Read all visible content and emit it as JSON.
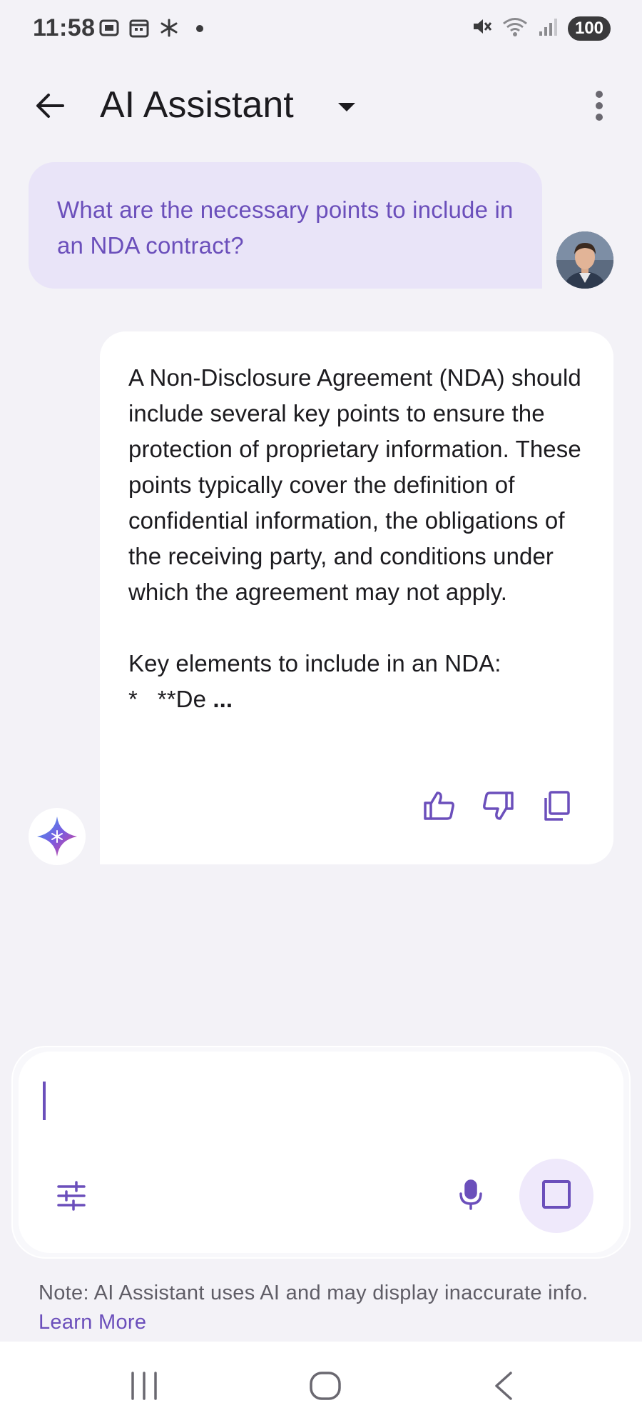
{
  "status_bar": {
    "time": "11:58",
    "battery": "100",
    "icons": [
      "screenshot-icon",
      "calendar-icon",
      "asterisk-icon",
      "dot-icon",
      "mute-icon",
      "wifi-icon",
      "signal-icon"
    ]
  },
  "app_bar": {
    "title": "AI Assistant",
    "icons": [
      "back-arrow-icon",
      "dropdown-caret-icon",
      "more-vert-icon"
    ]
  },
  "conversation": {
    "user_message": "What are the necessary points to include in an NDA contract?",
    "assistant_message": "A Non-Disclosure Agreement (NDA) should include several key points to ensure the protection of proprietary information. These points typically cover the definition of confidential information, the obligations of the receiving party, and conditions under which the agreement may not apply.\n\nKey elements to include in an NDA:\n*   **De",
    "assistant_ellipsis": "...",
    "feedback_icons": [
      "thumb-up-icon",
      "thumb-down-icon",
      "copy-icon"
    ]
  },
  "composer": {
    "input_value": "",
    "icons": [
      "tune-icon",
      "mic-icon",
      "stop-icon"
    ]
  },
  "footer": {
    "note_text": "Note: AI Assistant uses AI and may display inaccurate info. ",
    "learn_more": "Learn More"
  },
  "colors": {
    "accent": "#6b4fbb",
    "user_bubble": "#e9e4f8",
    "background": "#f3f2f7"
  },
  "nav_bar": {
    "icons": [
      "recents-icon",
      "home-icon",
      "back-icon"
    ]
  }
}
